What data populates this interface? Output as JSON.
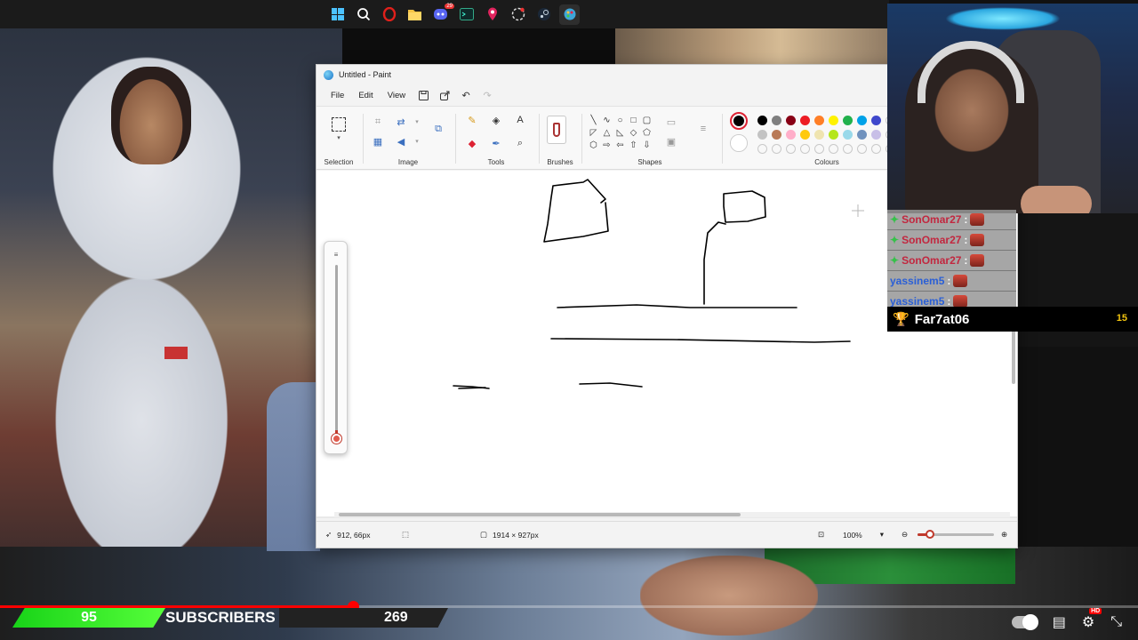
{
  "taskbar": {
    "icons": [
      "windows-icon",
      "search-icon",
      "opera-icon",
      "file-explorer-icon",
      "discord-icon",
      "terminal-icon",
      "maps-pin-icon",
      "clock-badge-icon",
      "steam-icon",
      "paint-icon"
    ],
    "discord_badge": "29"
  },
  "paint": {
    "title": "Untitled - Paint",
    "menu": {
      "file": "File",
      "edit": "Edit",
      "view": "View"
    },
    "groups": {
      "selection": "Selection",
      "image": "Image",
      "tools": "Tools",
      "brushes": "Brushes",
      "shapes": "Shapes",
      "colours": "Colours"
    },
    "palette": [
      "#000000",
      "#7f7f7f",
      "#880015",
      "#ed1c24",
      "#ff7f27",
      "#fff200",
      "#22b14c",
      "#00a2e8",
      "#3f48cc",
      "#ffffff",
      "#c3c3c3",
      "#b97a57",
      "#ffaec9",
      "#ffc90e",
      "#efe4b0",
      "#b5e61d",
      "#99d9ea",
      "#7092be",
      "#c8bfe7"
    ],
    "colour1": "#000000",
    "colour2": "#ffffff",
    "status": {
      "cursor_pos": "912, 66px",
      "canvas_size": "1914 × 927px",
      "zoom": "100%"
    }
  },
  "chat": {
    "messages": [
      {
        "user": "SonOmar27",
        "color": "red"
      },
      {
        "user": "SonOmar27",
        "color": "red"
      },
      {
        "user": "SonOmar27",
        "color": "red"
      },
      {
        "user": "yassinem5",
        "color": "blue"
      },
      {
        "user": "yassinem5",
        "color": "blue"
      }
    ],
    "separator": ":"
  },
  "top_follower": {
    "name": "Far7at06",
    "count": "15"
  },
  "subscriber_goal": {
    "current": "95",
    "label": "SUBSCRIBERS",
    "goal": "269"
  },
  "player": {
    "progress": 0.31,
    "hd_badge": "HD"
  }
}
